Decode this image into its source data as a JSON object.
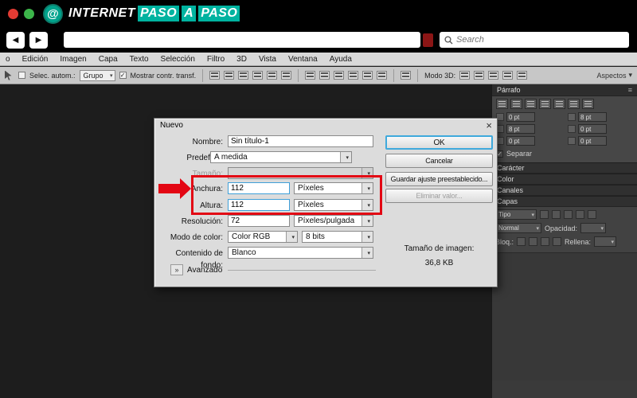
{
  "brand": {
    "logo_glyph": "@",
    "name_primary": "INTERNET",
    "name_box_1": "PASO",
    "name_box_2": "A",
    "name_box_3": "PASO",
    "accent_color": "#00b3a0"
  },
  "navbar": {
    "back_glyph": "◀",
    "forward_glyph": "▶",
    "search_placeholder": "Search"
  },
  "menu_bar": {
    "items": [
      "o",
      "Edición",
      "Imagen",
      "Capa",
      "Texto",
      "Selección",
      "Filtro",
      "3D",
      "Vista",
      "Ventana",
      "Ayuda"
    ]
  },
  "options_bar": {
    "auto_select_label": "Selec. autom.:",
    "group_value": "Grupo",
    "show_transform_label": "Mostrar contr. transf.",
    "mode3d_label": "Modo 3D:",
    "aspects_label": "Aspectos"
  },
  "dialog": {
    "title": "Nuevo",
    "close_glyph": "×",
    "name_label": "Nombre:",
    "name_value": "Sin título-1",
    "preset_label": "Predefinir:",
    "preset_value": "A medida",
    "size_label": "Tamaño:",
    "width_label": "Anchura:",
    "width_value": "112",
    "width_unit": "Píxeles",
    "height_label": "Altura:",
    "height_value": "112",
    "height_unit": "Píxeles",
    "resolution_label": "Resolución:",
    "resolution_value": "72",
    "resolution_unit": "Píxeles/pulgada",
    "color_mode_label": "Modo de color:",
    "color_mode_value": "Color RGB",
    "bit_depth_value": "8 bits",
    "background_label": "Contenido de fondo:",
    "background_value": "Blanco",
    "advanced_label": "Avanzado",
    "advanced_glyph": "»",
    "ok_label": "OK",
    "cancel_label": "Cancelar",
    "save_preset_label": "Guardar ajuste preestablecido...",
    "delete_preset_label": "Eliminar valor...",
    "image_size_label": "Tamaño de imagen:",
    "image_size_value": "36,8 KB"
  },
  "panels": {
    "paragraph": {
      "title": "Párrafo",
      "menu_glyph": "≡",
      "field_values": [
        "0 pt",
        "8 pt",
        "8 pt",
        "0 pt",
        "0 pt",
        "0 pt"
      ],
      "separate_label": "Separar"
    },
    "character_title": "Carácter",
    "color_title": "Color",
    "channels_title": "Canales",
    "layers": {
      "title": "Capas",
      "filter_label": "Tipo",
      "blend_mode_value": "Normal",
      "opacity_label": "Opacidad:",
      "lock_label": "Bloq.:",
      "fill_label": "Rellena:"
    }
  },
  "annotation": {
    "highlight_color": "#e30613"
  }
}
